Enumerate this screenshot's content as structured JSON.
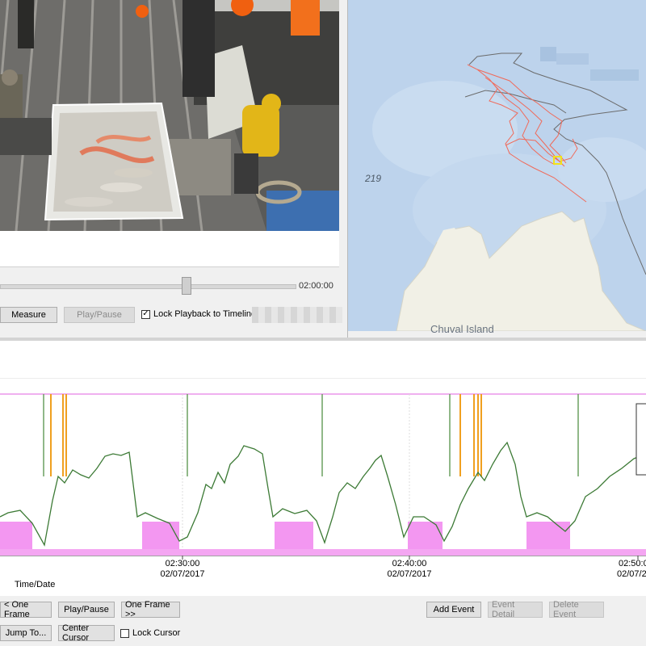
{
  "video": {
    "time_display": "02:00:00",
    "seek_position": 0.62,
    "measure_label": "Measure",
    "playpause_label": "Play/Pause",
    "lock_playback_label": "Lock Playback to Timeline",
    "lock_playback_checked": true,
    "lock_checkmark": "✓"
  },
  "map": {
    "depth_label": "219",
    "island_label": "Chuval Island"
  },
  "timeline": {
    "xlabel": "Time/Date",
    "ticks": [
      {
        "time": "02:30:00",
        "date": "02/07/2017"
      },
      {
        "time": "02:40:00",
        "date": "02/07/2017"
      },
      {
        "time": "02:50:0",
        "date": "02/07/20"
      }
    ]
  },
  "controls": {
    "prev_frame_label": "< One Frame",
    "playpause_label": "Play/Pause",
    "next_frame_label": "One Frame >>",
    "add_event_label": "Add Event",
    "event_detail_label": "Event Detail",
    "delete_event_label": "Delete Event",
    "jump_to_label": "Jump To...",
    "center_cursor_label": "Center Cursor",
    "lock_cursor_label": "Lock Cursor",
    "lock_cursor_checked": false
  },
  "colors": {
    "depth_line": "#3c7a35",
    "activity_fill": "#f28cf0",
    "event_orange": "#f0a020",
    "event_green": "#6aa060",
    "track_red": "#f06a5a",
    "track_gray": "#6b6b6b"
  }
}
